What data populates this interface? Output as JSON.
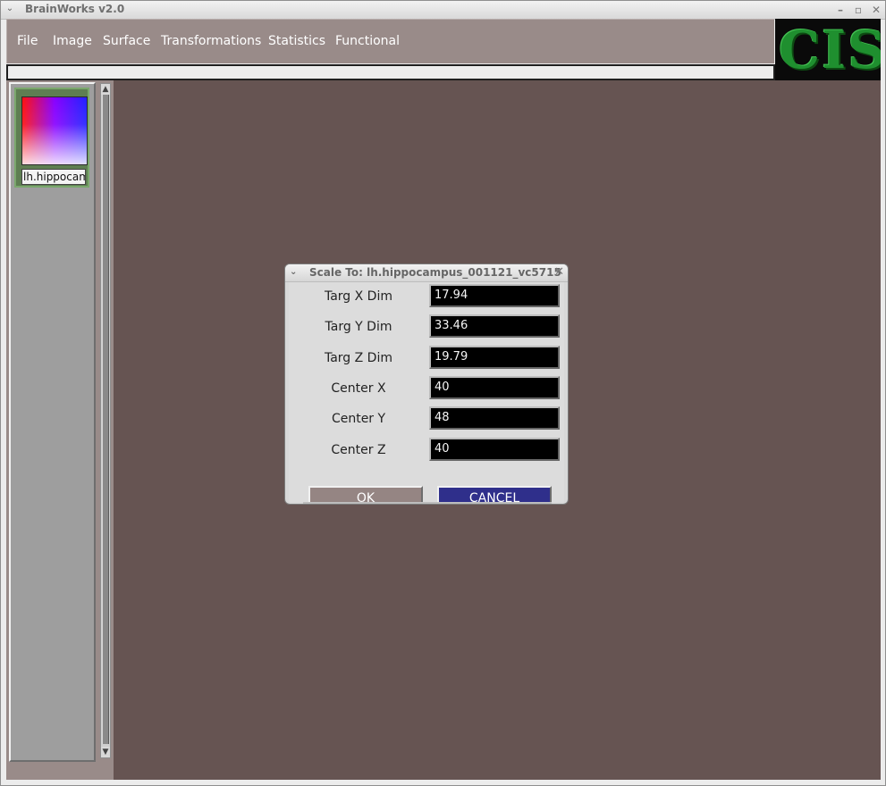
{
  "window": {
    "title": "BrainWorks v2.0"
  },
  "menu": {
    "items": [
      {
        "label": "File"
      },
      {
        "label": "Image"
      },
      {
        "label": "Surface"
      },
      {
        "label": "Transformations"
      },
      {
        "label": "Statistics"
      },
      {
        "label": "Functional"
      }
    ]
  },
  "logo": {
    "text": "CIS"
  },
  "thumbnail": {
    "label": "lh.hippocamp"
  },
  "dialog": {
    "title": "Scale To: lh.hippocampus_001121_vc5715",
    "fields": [
      {
        "label": "Targ X Dim",
        "value": "17.94"
      },
      {
        "label": "Targ Y Dim",
        "value": "33.46"
      },
      {
        "label": "Targ Z Dim",
        "value": "19.79"
      },
      {
        "label": "Center X",
        "value": "40"
      },
      {
        "label": "Center Y",
        "value": "48"
      },
      {
        "label": "Center Z",
        "value": "40"
      }
    ],
    "buttons": {
      "ok": "OK",
      "cancel": "CANCEL"
    }
  },
  "icons": {
    "window_menu": "chevron-down-icon",
    "minimize": "minimize-icon",
    "maximize": "maximize-icon",
    "close": "close-icon",
    "scroll_up": "arrow-up-icon",
    "scroll_down": "arrow-down-icon"
  },
  "colors": {
    "menu_bg": "#998b89",
    "workspace_bg": "#665452",
    "thumbnail_border": "#5e7e52",
    "ok_button": "#958583",
    "cancel_button": "#2f2f8b",
    "logo_green": "#1f8f2f"
  }
}
